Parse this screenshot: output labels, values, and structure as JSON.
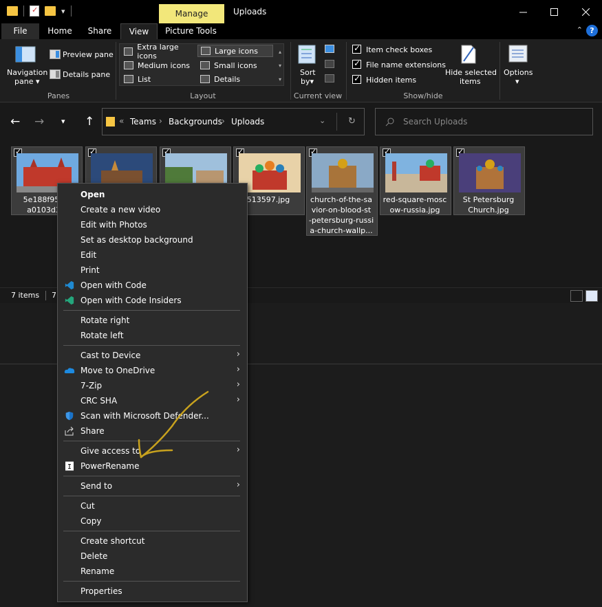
{
  "window": {
    "title": "Uploads",
    "contextual_tab": "Manage"
  },
  "tabs": [
    "File",
    "Home",
    "Share",
    "View",
    "Picture Tools"
  ],
  "ribbon": {
    "panes": {
      "navigation_pane": "Navigation",
      "navigation_pane_sub": "pane",
      "preview_pane": "Preview pane",
      "details_pane": "Details pane",
      "group": "Panes"
    },
    "layout": {
      "extra_large": "Extra large icons",
      "large": "Large icons",
      "medium": "Medium icons",
      "small": "Small icons",
      "list": "List",
      "details": "Details",
      "group": "Layout"
    },
    "current_view": {
      "sort": "Sort",
      "sort_sub": "by",
      "group": "Current view"
    },
    "show_hide": {
      "item_check_boxes": "Item check boxes",
      "file_name_extensions": "File name extensions",
      "hidden_items": "Hidden items",
      "hide_selected": "Hide selected",
      "hide_selected_sub": "items",
      "group": "Show/hide"
    },
    "options": "Options"
  },
  "address": {
    "overflow": "«",
    "crumbs": [
      "Teams",
      "Backgrounds",
      "Uploads"
    ]
  },
  "search": {
    "placeholder": "Search Uploads"
  },
  "files": [
    {
      "name": "5e188f9515 a0103d3b",
      "line1": "5e188f9515",
      "line2": "a0103d3b"
    },
    {
      "name": "",
      "line1": "",
      "line2": ""
    },
    {
      "name": "",
      "line1": "",
      "line2": ""
    },
    {
      "name": "513597.jpg",
      "line1": "513597.jpg",
      "line2": ""
    },
    {
      "name": "church-of-the-savior-on-blood-st-petersburg-russia-church-wallp...",
      "line1": "church-of-the-sa",
      "line2": "vior-on-blood-st",
      "line3": "-petersburg-russi",
      "line4": "a-church-wallp..."
    },
    {
      "name": "red-square-moscow-russia.jpg",
      "line1": "red-square-mosc",
      "line2": "ow-russia.jpg"
    },
    {
      "name": "St Petersburg Church.jpg",
      "line1": "St Petersburg",
      "line2": "Church.jpg"
    }
  ],
  "status": {
    "items": "7 items",
    "selected": "7"
  },
  "context_menu": {
    "open": "Open",
    "create_video": "Create a new video",
    "edit_photos": "Edit with Photos",
    "set_desktop": "Set as desktop background",
    "edit": "Edit",
    "print": "Print",
    "open_code": "Open with Code",
    "open_code_insiders": "Open with Code Insiders",
    "rotate_right": "Rotate right",
    "rotate_left": "Rotate left",
    "cast": "Cast to Device",
    "onedrive": "Move to OneDrive",
    "zip": "7-Zip",
    "crc": "CRC SHA",
    "defender": "Scan with Microsoft Defender...",
    "share": "Share",
    "give_access": "Give access to",
    "powerrename": "PowerRename",
    "send_to": "Send to",
    "cut": "Cut",
    "copy": "Copy",
    "create_shortcut": "Create shortcut",
    "delete": "Delete",
    "rename": "Rename",
    "properties": "Properties"
  },
  "colors": {
    "accent": "#f2e77a",
    "annotation": "#c8a21e",
    "help": "#1e6fd9"
  }
}
